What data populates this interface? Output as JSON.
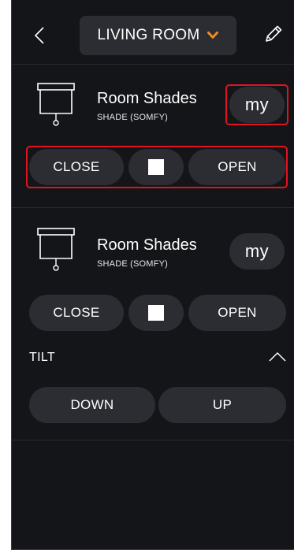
{
  "header": {
    "room_name": "LIVING ROOM",
    "back_icon": "chevron-left-icon",
    "dropdown_icon": "chevron-down-icon",
    "edit_icon": "pencil-icon",
    "accent_color": "#f08a24"
  },
  "devices": [
    {
      "name": "Room Shades",
      "type": "SHADE (SOMFY)",
      "icon": "shade-icon",
      "my_label": "my",
      "controls": {
        "close": "CLOSE",
        "stop_icon": "stop-icon",
        "open": "OPEN"
      }
    },
    {
      "name": "Room Shades",
      "type": "SHADE (SOMFY)",
      "icon": "shade-icon",
      "my_label": "my",
      "controls": {
        "close": "CLOSE",
        "stop_icon": "stop-icon",
        "open": "OPEN"
      },
      "tilt": {
        "label": "TILT",
        "toggle_icon": "chevron-up-icon",
        "down": "DOWN",
        "up": "UP"
      }
    }
  ],
  "colors": {
    "background": "#141518",
    "button": "#2b2d32",
    "highlight": "#e0141e"
  }
}
